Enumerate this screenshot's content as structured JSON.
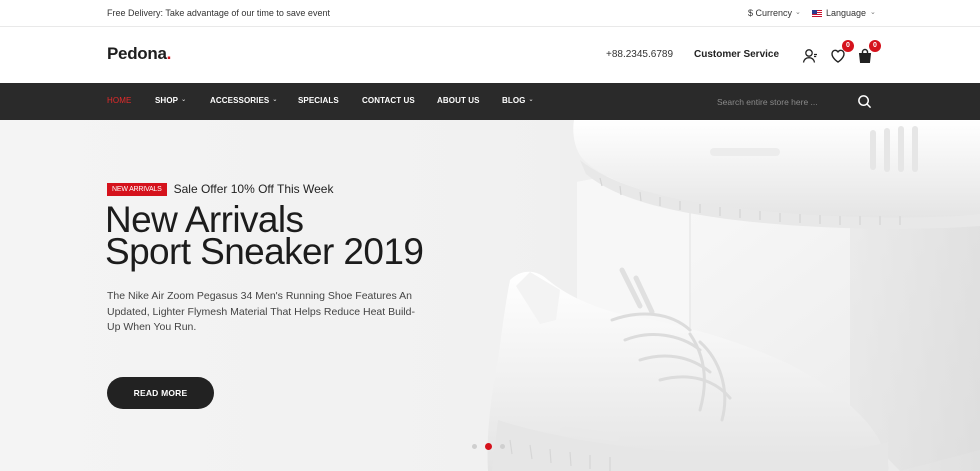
{
  "topbar": {
    "promo": "Free Delivery: Take advantage of our time to save event",
    "currency_label": "$ Currency",
    "language_label": "Language"
  },
  "header": {
    "logo_text": "Pedona",
    "logo_dot": ".",
    "phone": "+88.2345.6789",
    "customer_service": "Customer Service",
    "wishlist_count": "0",
    "cart_count": "0"
  },
  "nav": {
    "items": [
      {
        "label": "HOME",
        "has_dropdown": false,
        "active": true
      },
      {
        "label": "SHOP",
        "has_dropdown": true
      },
      {
        "label": "ACCESSORIES",
        "has_dropdown": true
      },
      {
        "label": "SPECIALS",
        "has_dropdown": false
      },
      {
        "label": "CONTACT US",
        "has_dropdown": false
      },
      {
        "label": "ABOUT US",
        "has_dropdown": false
      },
      {
        "label": "BLOG",
        "has_dropdown": true
      }
    ],
    "search_placeholder": "Search entire store here ..."
  },
  "hero": {
    "tag": "NEW ARRIVALS",
    "offer": "Sale Offer 10% Off This Week",
    "title_line1": "New Arrivals",
    "title_line2": "Sport Sneaker 2019",
    "description": "The Nike Air Zoom Pegasus 34 Men's Running Shoe Features An Updated, Lighter Flymesh Material That Helps Reduce Heat Build-Up When You Run.",
    "button_label": "READ MORE",
    "slides": 3,
    "active_slide": 2
  },
  "colors": {
    "accent": "#d5121c",
    "nav_bg": "#2a2a2a",
    "button_bg": "#222222"
  },
  "icons": {
    "currency_chevron": "chevron-down-icon",
    "language_flag": "flag-icon",
    "account": "user-icon",
    "wishlist": "heart-icon",
    "cart": "shopping-bag-icon",
    "search": "search-icon"
  }
}
